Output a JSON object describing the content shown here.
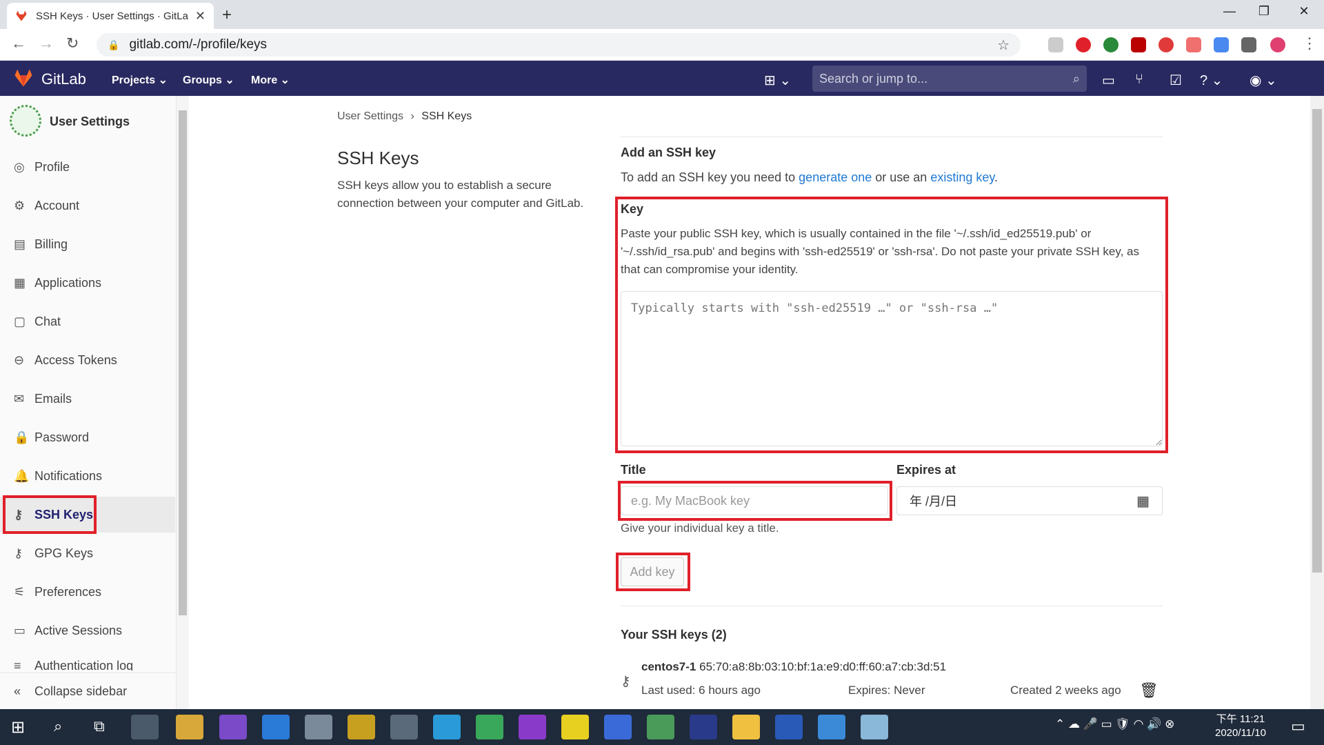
{
  "browser": {
    "tab_title": "SSH Keys · User Settings · GitLa",
    "url": "gitlab.com/-/profile/keys",
    "new_tab": "+"
  },
  "gitlab_header": {
    "brand": "GitLab",
    "nav": [
      "Projects",
      "Groups",
      "More"
    ],
    "search_placeholder": "Search or jump to..."
  },
  "sidebar": {
    "title": "User Settings",
    "items": [
      {
        "label": "Profile",
        "icon": "profile-icon"
      },
      {
        "label": "Account",
        "icon": "account-icon"
      },
      {
        "label": "Billing",
        "icon": "billing-icon"
      },
      {
        "label": "Applications",
        "icon": "applications-icon"
      },
      {
        "label": "Chat",
        "icon": "chat-icon"
      },
      {
        "label": "Access Tokens",
        "icon": "token-icon"
      },
      {
        "label": "Emails",
        "icon": "email-icon"
      },
      {
        "label": "Password",
        "icon": "lock-icon"
      },
      {
        "label": "Notifications",
        "icon": "bell-icon"
      },
      {
        "label": "SSH Keys",
        "icon": "key-icon",
        "active": true
      },
      {
        "label": "GPG Keys",
        "icon": "key-icon"
      },
      {
        "label": "Preferences",
        "icon": "preferences-icon"
      },
      {
        "label": "Active Sessions",
        "icon": "monitor-icon"
      },
      {
        "label": "Authentication log",
        "icon": "log-icon"
      }
    ],
    "collapse_label": "Collapse sidebar"
  },
  "breadcrumb": {
    "parent": "User Settings",
    "current": "SSH Keys"
  },
  "page": {
    "heading": "SSH Keys",
    "description": "SSH keys allow you to establish a secure connection between your computer and GitLab."
  },
  "form": {
    "add_heading": "Add an SSH key",
    "add_text_before": "To add an SSH key you need to ",
    "generate_link": "generate one",
    "add_text_middle": " or use an ",
    "existing_link": "existing key",
    "add_text_after": ".",
    "key_label": "Key",
    "key_help": "Paste your public SSH key, which is usually contained in the file '~/.ssh/id_ed25519.pub' or '~/.ssh/id_rsa.pub' and begins with 'ssh-ed25519' or 'ssh-rsa'. Do not paste your private SSH key, as that can compromise your identity.",
    "key_placeholder": "Typically starts with \"ssh-ed25519 …\" or \"ssh-rsa …\"",
    "title_label": "Title",
    "title_placeholder": "e.g. My MacBook key",
    "title_help": "Give your individual key a title.",
    "expires_label": "Expires at",
    "expires_placeholder": "年 /月/日",
    "submit_label": "Add key"
  },
  "keys": {
    "heading": "Your SSH keys (2)",
    "items": [
      {
        "name": "centos7-1",
        "fingerprint": "65:70:a8:8b:03:10:bf:1a:e9:d0:ff:60:a7:cb:3d:51",
        "last_used": "Last used: 6 hours ago",
        "expires": "Expires: Never",
        "created": "Created 2 weeks ago"
      }
    ]
  },
  "taskbar": {
    "time": "下午 11:21",
    "date": "2020/11/10"
  },
  "colors": {
    "header": "#292961",
    "highlight": "#e0202a",
    "link": "#1f78d1"
  }
}
